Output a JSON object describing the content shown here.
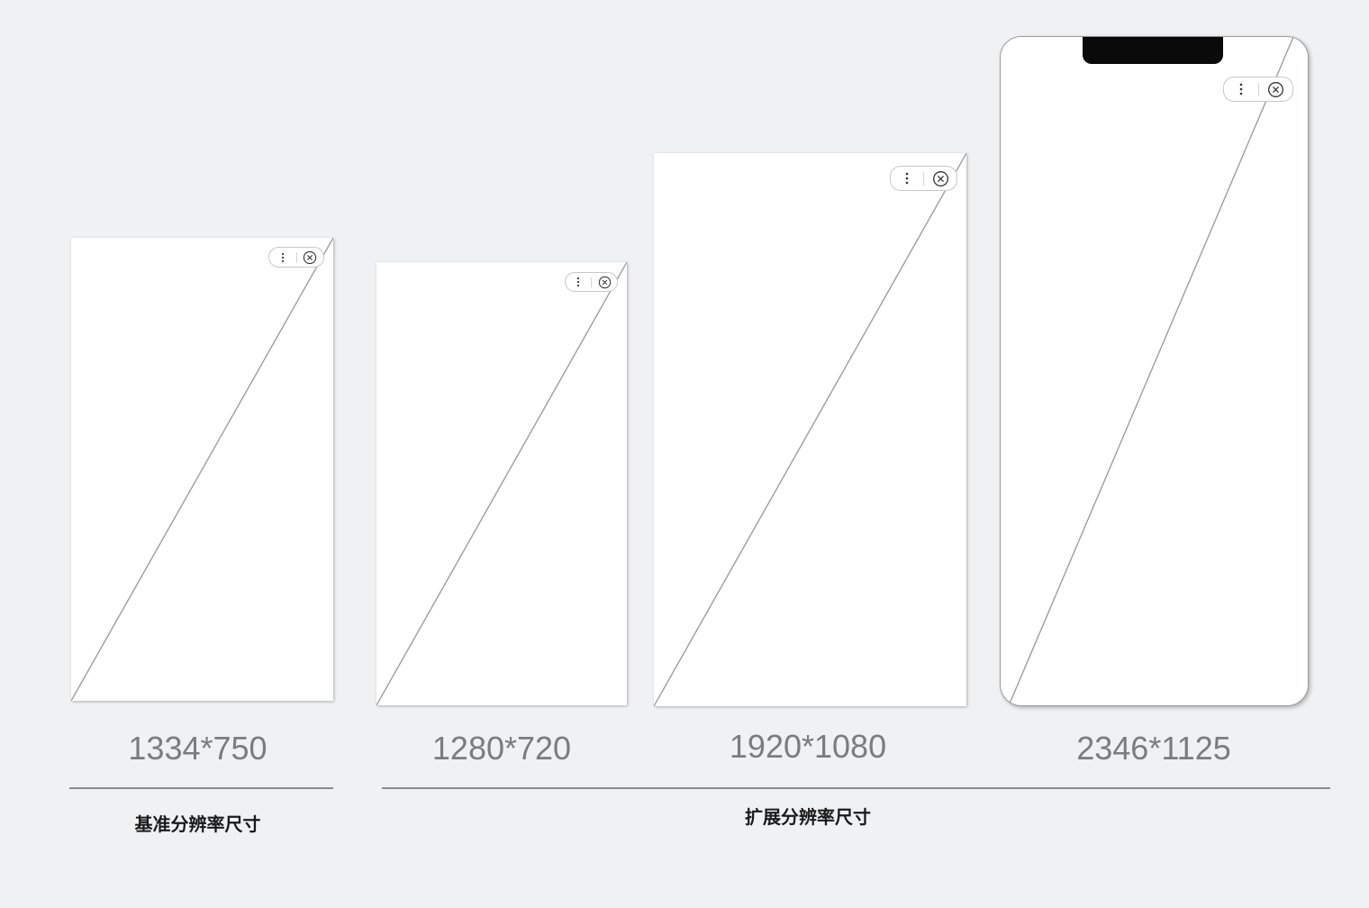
{
  "screens": [
    {
      "resolution": "1334*750"
    },
    {
      "resolution": "1280*720"
    },
    {
      "resolution": "1920*1080"
    },
    {
      "resolution": "2346*1125"
    }
  ],
  "groups": [
    {
      "label": "基准分辨率尺寸"
    },
    {
      "label": "扩展分辨率尺寸"
    }
  ],
  "icons": {
    "menu": "more-dots-icon",
    "close": "close-circle-icon"
  },
  "colors": {
    "background": "#f0f1f3",
    "screen": "#ffffff",
    "diagonal": "#9e9e9e",
    "label": "#7c7c7c",
    "divider": "#8c8c8c",
    "notch": "#0a0a0a"
  }
}
